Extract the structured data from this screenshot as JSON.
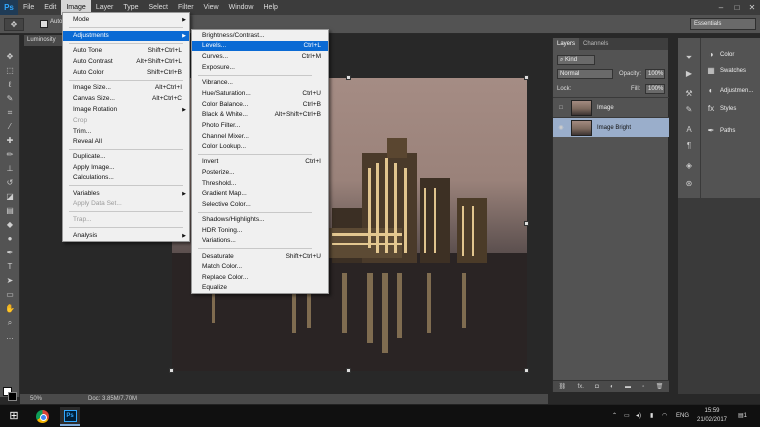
{
  "app": {
    "logo": "Ps"
  },
  "menubar": {
    "items": [
      "File",
      "Edit",
      "Image",
      "Layer",
      "Type",
      "Select",
      "Filter",
      "View",
      "Window",
      "Help"
    ],
    "active": "Image"
  },
  "options_bar": {
    "auto_label": "Auto",
    "workspace": "Essentials"
  },
  "document_tab": {
    "label": "Luminosity"
  },
  "status": {
    "zoom": "50%",
    "doc_size": "Doc: 3.85M/7.70M"
  },
  "image_menu": {
    "mode": "Mode",
    "adjustments": "Adjustments",
    "auto_tone": {
      "label": "Auto Tone",
      "shortcut": "Shift+Ctrl+L"
    },
    "auto_contrast": {
      "label": "Auto Contrast",
      "shortcut": "Alt+Shift+Ctrl+L"
    },
    "auto_color": {
      "label": "Auto Color",
      "shortcut": "Shift+Ctrl+B"
    },
    "image_size": {
      "label": "Image Size...",
      "shortcut": "Alt+Ctrl+I"
    },
    "canvas_size": {
      "label": "Canvas Size...",
      "shortcut": "Alt+Ctrl+C"
    },
    "image_rotation": "Image Rotation",
    "crop": "Crop",
    "trim": "Trim...",
    "reveal_all": "Reveal All",
    "duplicate": "Duplicate...",
    "apply_image": "Apply Image...",
    "calculations": "Calculations...",
    "variables": "Variables",
    "apply_data_set": "Apply Data Set...",
    "trap": "Trap...",
    "analysis": "Analysis"
  },
  "adjustments_menu": {
    "brightness_contrast": "Brightness/Contrast...",
    "levels": {
      "label": "Levels...",
      "shortcut": "Ctrl+L"
    },
    "curves": {
      "label": "Curves...",
      "shortcut": "Ctrl+M"
    },
    "exposure": "Exposure...",
    "vibrance": "Vibrance...",
    "hue_saturation": {
      "label": "Hue/Saturation...",
      "shortcut": "Ctrl+U"
    },
    "color_balance": {
      "label": "Color Balance...",
      "shortcut": "Ctrl+B"
    },
    "black_white": {
      "label": "Black & White...",
      "shortcut": "Alt+Shift+Ctrl+B"
    },
    "photo_filter": "Photo Filter...",
    "channel_mixer": "Channel Mixer...",
    "color_lookup": "Color Lookup...",
    "invert": {
      "label": "Invert",
      "shortcut": "Ctrl+I"
    },
    "posterize": "Posterize...",
    "threshold": "Threshold...",
    "gradient_map": "Gradient Map...",
    "selective_color": "Selective Color...",
    "shadows_highlights": "Shadows/Highlights...",
    "hdr_toning": "HDR Toning...",
    "variations": "Variations...",
    "desaturate": {
      "label": "Desaturate",
      "shortcut": "Shift+Ctrl+U"
    },
    "match_color": "Match Color...",
    "replace_color": "Replace Color...",
    "equalize": "Equalize"
  },
  "layers_panel": {
    "tabs": [
      "Layers",
      "Channels"
    ],
    "kind": "Kind",
    "blend_mode": "Normal",
    "opacity_label": "Opacity:",
    "opacity": "100%",
    "lock_label": "Lock:",
    "fill_label": "Fill:",
    "fill": "100%",
    "layers": [
      {
        "name": "Image",
        "selected": false
      },
      {
        "name": "Image Bright",
        "selected": true
      }
    ],
    "footer_icons": [
      "link-icon",
      "fx-icon",
      "mask-icon",
      "adjustment-icon",
      "group-icon",
      "new-layer-icon",
      "trash-icon"
    ],
    "footer_fx": "fx."
  },
  "side_panels": [
    "Color",
    "Swatches",
    "Adjustmen...",
    "Styles",
    "Paths"
  ],
  "taskbar": {
    "language": "ENG",
    "time": "15:59",
    "date": "21/02/2017",
    "notifications": "1"
  }
}
